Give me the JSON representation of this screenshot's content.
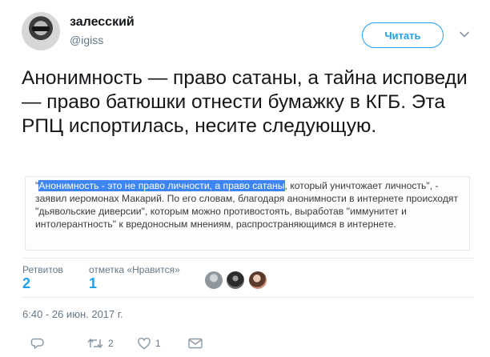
{
  "author": {
    "display_name": "залесский",
    "handle": "@igiss"
  },
  "follow_button_label": "Читать",
  "tweet_text": "Анонимность — право сатаны, а тайна исповеди — право батюшки отнести бумажку в КГБ. Эта РПЦ испортилась, несите следующую.",
  "quoted": {
    "highlighted": "Анонимность - это не право личности, а право сатаны",
    "rest": ", который уничтожает личность\", - заявил иеромонах Макарий. По его словам, благодаря анонимности в интернете происходят \"дьявольские диверсии\", которым можно противостоять, выработав \"иммунитет и интолерантность\" к вредоносным мнениям, распространяющимся в интернете.",
    "opening_quote": "\""
  },
  "stats": {
    "retweets_label": "Ретвитов",
    "retweets_count": "2",
    "likes_label": "отметка «Нравится»",
    "likes_count": "1"
  },
  "liker_avatars": [
    "avatar-1",
    "avatar-2",
    "avatar-3"
  ],
  "timestamp": "6:40 - 26 июн. 2017 г.",
  "actions": {
    "reply_icon": "reply-icon",
    "retweet_icon": "retweet-icon",
    "retweet_count": "2",
    "like_icon": "heart-icon",
    "like_count": "1",
    "dm_icon": "envelope-icon"
  },
  "colors": {
    "accent": "#1da1f2",
    "muted": "#657786",
    "highlight": "#3d84f5"
  }
}
